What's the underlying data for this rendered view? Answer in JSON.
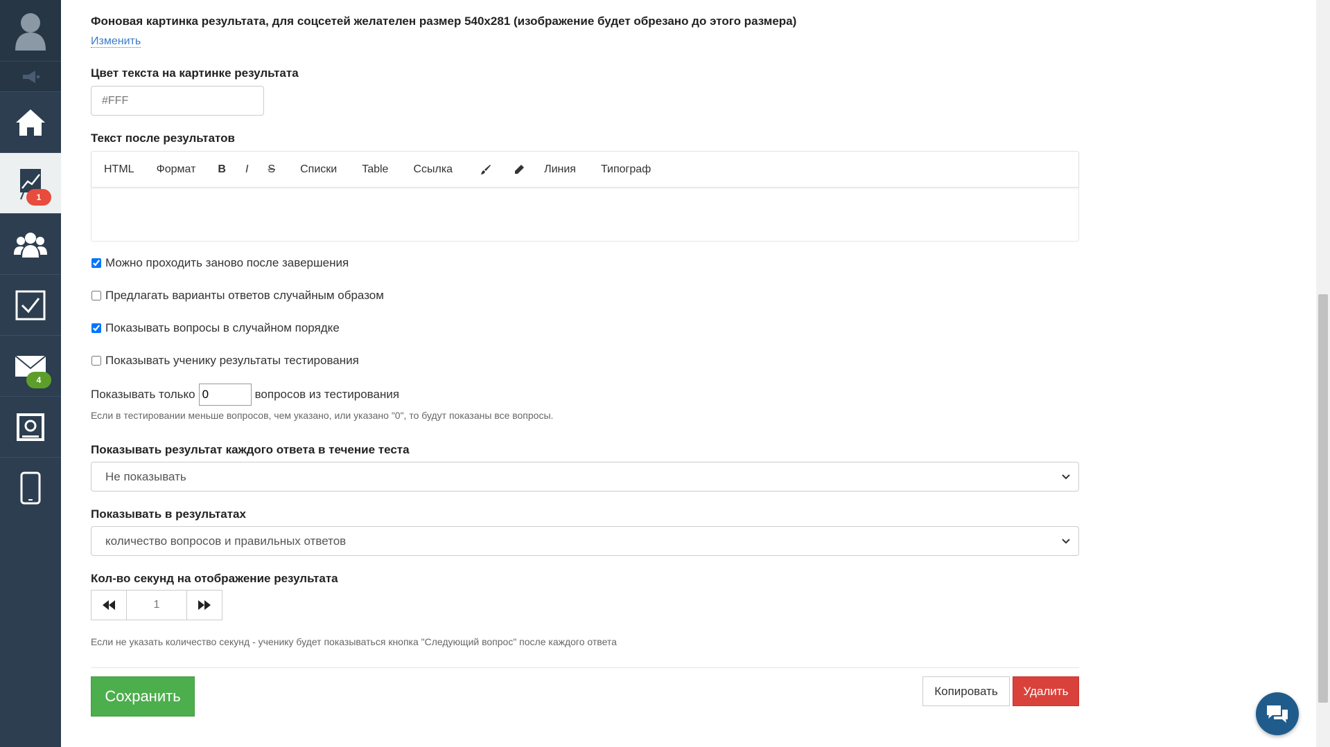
{
  "sidebar": {
    "items": [
      {
        "icon": "home-icon"
      },
      {
        "icon": "chart-icon",
        "badge": "1",
        "badge_color": "#e74c3c"
      },
      {
        "icon": "users-icon"
      },
      {
        "icon": "checkbox-icon"
      },
      {
        "icon": "mail-icon",
        "badge": "4",
        "badge_color": "#5d9e2b"
      },
      {
        "icon": "settings-icon"
      },
      {
        "icon": "mobile-icon"
      }
    ]
  },
  "background_image": {
    "label": "Фоновая картинка результата, для соцсетей желателен размер 540x281 (изображение будет обрезано до этого размера)",
    "change_link": "Изменить"
  },
  "text_color": {
    "label": "Цвет текста на картинке результата",
    "value": "#FFF"
  },
  "after_text": {
    "label": "Текст после результатов",
    "toolbar": [
      "HTML",
      "Формат",
      "B",
      "I",
      "S",
      "Списки",
      "Table",
      "Ссылка",
      "Линия",
      "Типограф"
    ]
  },
  "checkboxes": [
    {
      "label": "Можно проходить заново после завершения",
      "checked": true
    },
    {
      "label": "Предлагать варианты ответов случайным образом",
      "checked": false
    },
    {
      "label": "Показывать вопросы в случайном порядке",
      "checked": true
    },
    {
      "label": "Показывать ученику результаты тестирования",
      "checked": false
    }
  ],
  "show_only": {
    "prefix": "Показывать только",
    "value": "0",
    "suffix": "вопросов из тестирования",
    "hint": "Если в тестировании меньше вопросов, чем указано, или указано \"0\", то будут показаны все вопросы."
  },
  "each_answer": {
    "label": "Показывать результат каждого ответа в течение теста",
    "selected": "Не показывать"
  },
  "in_results": {
    "label": "Показывать в результатах",
    "selected": "количество вопросов и правильных ответов"
  },
  "seconds": {
    "label": "Кол-во секунд на отображение результата",
    "value": "1",
    "hint": "Если не указать количество секунд - ученику будет показываться кнопка \"Следующий вопрос\" после каждого ответа"
  },
  "actions": {
    "save": "Сохранить",
    "copy": "Копировать",
    "delete": "Удалить"
  },
  "colors": {
    "sidebar": "#2c3e50",
    "save": "#4cae4c",
    "delete": "#d9423b",
    "link": "#3a7bc8",
    "chat": "#1f5c8c"
  }
}
